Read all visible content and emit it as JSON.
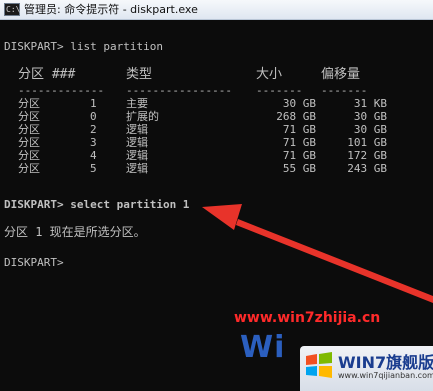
{
  "window": {
    "title": "管理员: 命令提示符 - diskpart.exe"
  },
  "console": {
    "cmd1": "DISKPART> list partition",
    "table": {
      "headers": [
        "分区 ###",
        "类型",
        "大小",
        "偏移量"
      ],
      "separator": [
        "-------------",
        "----------------",
        "-------",
        "-------"
      ],
      "rows": [
        {
          "name": "分区",
          "num": "1",
          "type": "主要",
          "size": "30 GB",
          "offset": "31 KB"
        },
        {
          "name": "分区",
          "num": "0",
          "type": "扩展的",
          "size": "268 GB",
          "offset": "30 GB"
        },
        {
          "name": "分区",
          "num": "2",
          "type": "逻辑",
          "size": "71 GB",
          "offset": "30 GB"
        },
        {
          "name": "分区",
          "num": "3",
          "type": "逻辑",
          "size": "71 GB",
          "offset": "101 GB"
        },
        {
          "name": "分区",
          "num": "4",
          "type": "逻辑",
          "size": "71 GB",
          "offset": "172 GB"
        },
        {
          "name": "分区",
          "num": "5",
          "type": "逻辑",
          "size": "55 GB",
          "offset": "243 GB"
        }
      ]
    },
    "cmd2": "DISKPART> select partition 1",
    "result": "分区 1 现在是所选分区。",
    "prompt": "DISKPART>"
  },
  "annotation": {
    "arrow_color": "#e8332a"
  },
  "watermark": {
    "site": "www.win7zhijia.cn",
    "logo_text": "Wi",
    "badge_title": "WIN7旗舰版",
    "badge_url": "www.win7qijianban.com"
  }
}
